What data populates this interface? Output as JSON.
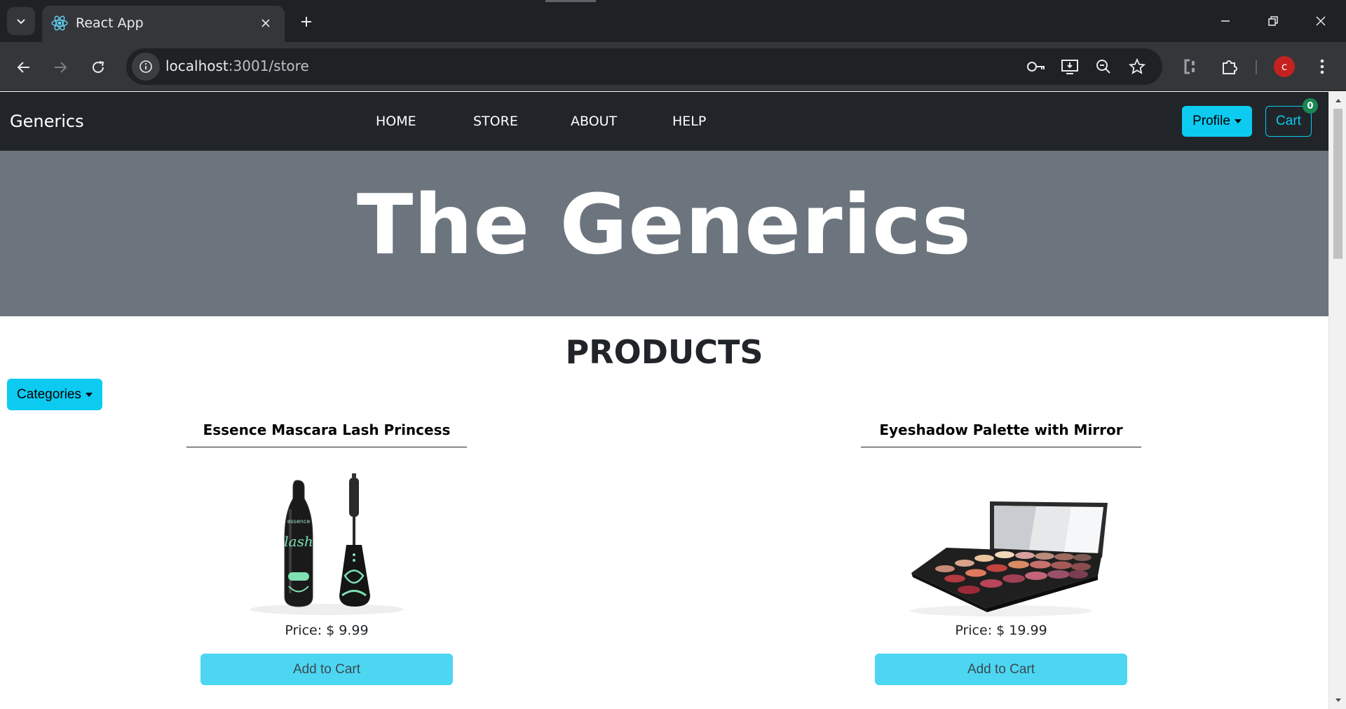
{
  "browser": {
    "tab_title": "React App",
    "url_host": "localhost",
    "url_path": ":3001/store",
    "profile_initial": "c"
  },
  "navbar": {
    "brand": "Generics",
    "links": [
      "HOME",
      "STORE",
      "ABOUT",
      "HELP"
    ],
    "profile_label": "Profile",
    "cart_label": "Cart",
    "cart_count": "0"
  },
  "hero": {
    "title": "The Generics"
  },
  "products_section": {
    "title": "PRODUCTS",
    "categories_label": "Categories",
    "items": [
      {
        "name": "Essence Mascara Lash Princess",
        "price": "Price: $ 9.99",
        "button": "Add to Cart"
      },
      {
        "name": "Eyeshadow Palette with Mirror",
        "price": "Price: $ 19.99",
        "button": "Add to Cart"
      }
    ]
  },
  "colors": {
    "navbar_bg": "#212529",
    "hero_bg": "#6c757d",
    "accent": "#0dcaf0",
    "badge": "#198754"
  }
}
